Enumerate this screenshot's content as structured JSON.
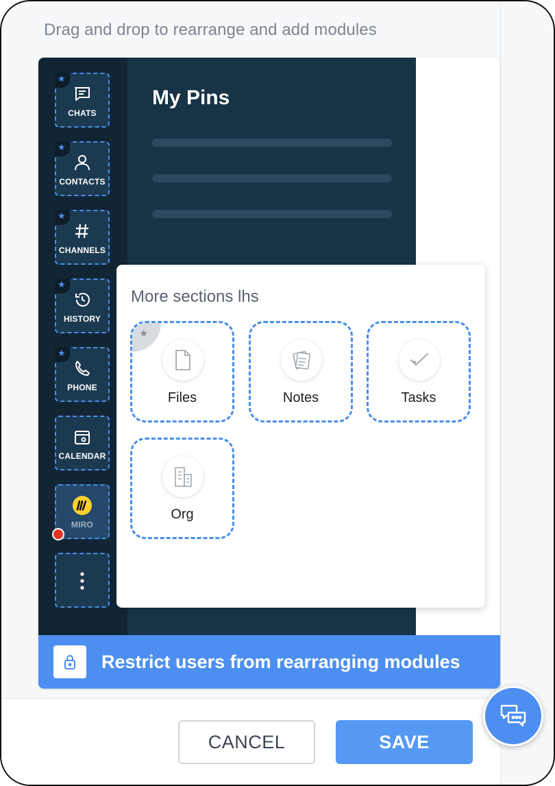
{
  "subtitle": "Drag and drop to rearrange and add modules",
  "preview": {
    "pins_title": "My Pins",
    "modules": [
      {
        "label": "CHATS",
        "icon": "chat-icon",
        "starred": true
      },
      {
        "label": "CONTACTS",
        "icon": "person-icon",
        "starred": true
      },
      {
        "label": "CHANNELS",
        "icon": "hash-icon",
        "starred": true
      },
      {
        "label": "HISTORY",
        "icon": "history-icon",
        "starred": true
      },
      {
        "label": "PHONE",
        "icon": "phone-icon",
        "starred": true
      },
      {
        "label": "CALENDAR",
        "icon": "calendar-icon",
        "starred": false
      },
      {
        "label": "MIRO",
        "icon": "miro-logo-icon",
        "starred": false,
        "badge": "red-dot"
      },
      {
        "label": "",
        "icon": "more-vertical-icon",
        "starred": false
      }
    ],
    "more_sections": {
      "title": "More sections lhs",
      "tiles": [
        {
          "label": "Files",
          "icon": "file-icon",
          "starred": true
        },
        {
          "label": "Notes",
          "icon": "notes-icon",
          "starred": false
        },
        {
          "label": "Tasks",
          "icon": "check-icon",
          "starred": false
        },
        {
          "label": "Org",
          "icon": "building-icon",
          "starred": false
        }
      ]
    },
    "restrict_label": "Restrict users from rearranging modules"
  },
  "footer": {
    "cancel_label": "CANCEL",
    "save_label": "SAVE"
  },
  "colors": {
    "accent": "#4d8ff0",
    "rail": "#122534",
    "panel": "#173346",
    "dashed_border": "#4a8ee8",
    "notification": "#e53224"
  }
}
